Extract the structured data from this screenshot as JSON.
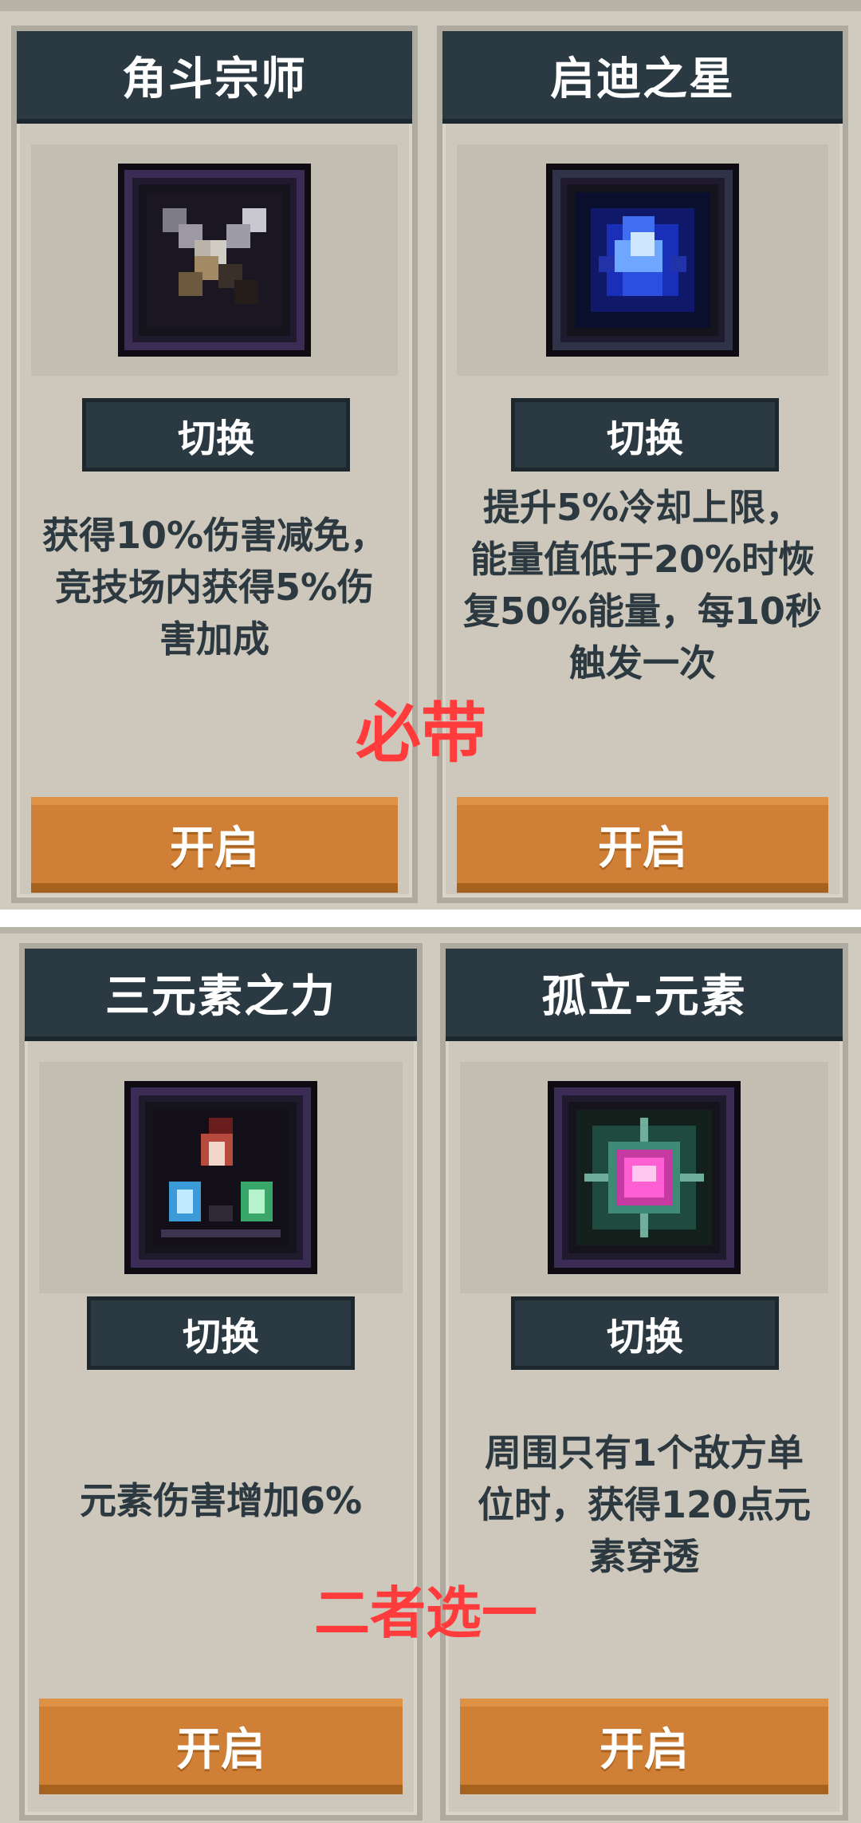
{
  "cards": [
    {
      "title": "角斗宗师",
      "icon": "crossed-swords-icon",
      "switch_label": "切换",
      "desc_lines": [
        "获得10%伤害减免，",
        "竞技场内获得5%伤",
        "害加成"
      ],
      "open_label": "开启"
    },
    {
      "title": "启迪之星",
      "icon": "blue-star-crystal-icon",
      "switch_label": "切换",
      "desc_lines": [
        "提升5%冷却上限，",
        "能量值低于20%时恢",
        "复50%能量，每10秒",
        "触发一次"
      ],
      "open_label": "开启"
    },
    {
      "title": "三元素之力",
      "icon": "three-element-crystals-icon",
      "switch_label": "切换",
      "desc_lines": [
        "元素伤害增加6%"
      ],
      "open_label": "开启"
    },
    {
      "title": "孤立-元素",
      "icon": "isolated-element-gem-icon",
      "switch_label": "切换",
      "desc_lines": [
        "周围只有1个敌方单",
        "位时，获得120点元",
        "素穿透"
      ],
      "open_label": "开启"
    }
  ],
  "annotations": {
    "top": "必带",
    "bottom": "二者选一"
  },
  "colors": {
    "panel_bg": "#cfcbbe",
    "title_bar": "#2b3a42",
    "open_button": "#cf7f36",
    "annotation": "#ff3b3b",
    "desc_text": "#2d3940"
  }
}
